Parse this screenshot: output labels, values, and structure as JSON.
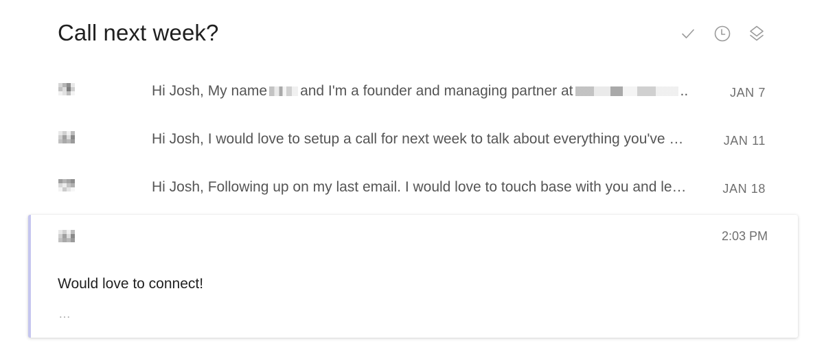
{
  "thread": {
    "subject": "Call next week?",
    "actions": [
      {
        "name": "done",
        "icon": "check-icon"
      },
      {
        "name": "remind",
        "icon": "clock-icon"
      },
      {
        "name": "move",
        "icon": "layers-icon"
      }
    ]
  },
  "messages": [
    {
      "avatar": "sender-avatar",
      "snippet_parts": [
        "Hi Josh, My name",
        "and I'm a founder and managing partner at",
        ".."
      ],
      "date": "JAN 7"
    },
    {
      "avatar": "sender-avatar",
      "snippet": "Hi Josh, I would love to setup a call for next week to talk about everything you've …",
      "date": "JAN 11"
    },
    {
      "avatar": "sender-avatar",
      "snippet": "Hi Josh, Following up on my last email. I would love to touch base with you and le…",
      "date": "JAN 18"
    }
  ],
  "open_message": {
    "avatar": "sender-avatar",
    "time": "2:03 PM",
    "body": "Would love to connect!",
    "more": "…"
  },
  "colors": {
    "accent_border": "#c5c6ef",
    "text_primary": "#1f1f1f",
    "text_secondary": "#555555",
    "text_muted": "#6f6f6f"
  }
}
